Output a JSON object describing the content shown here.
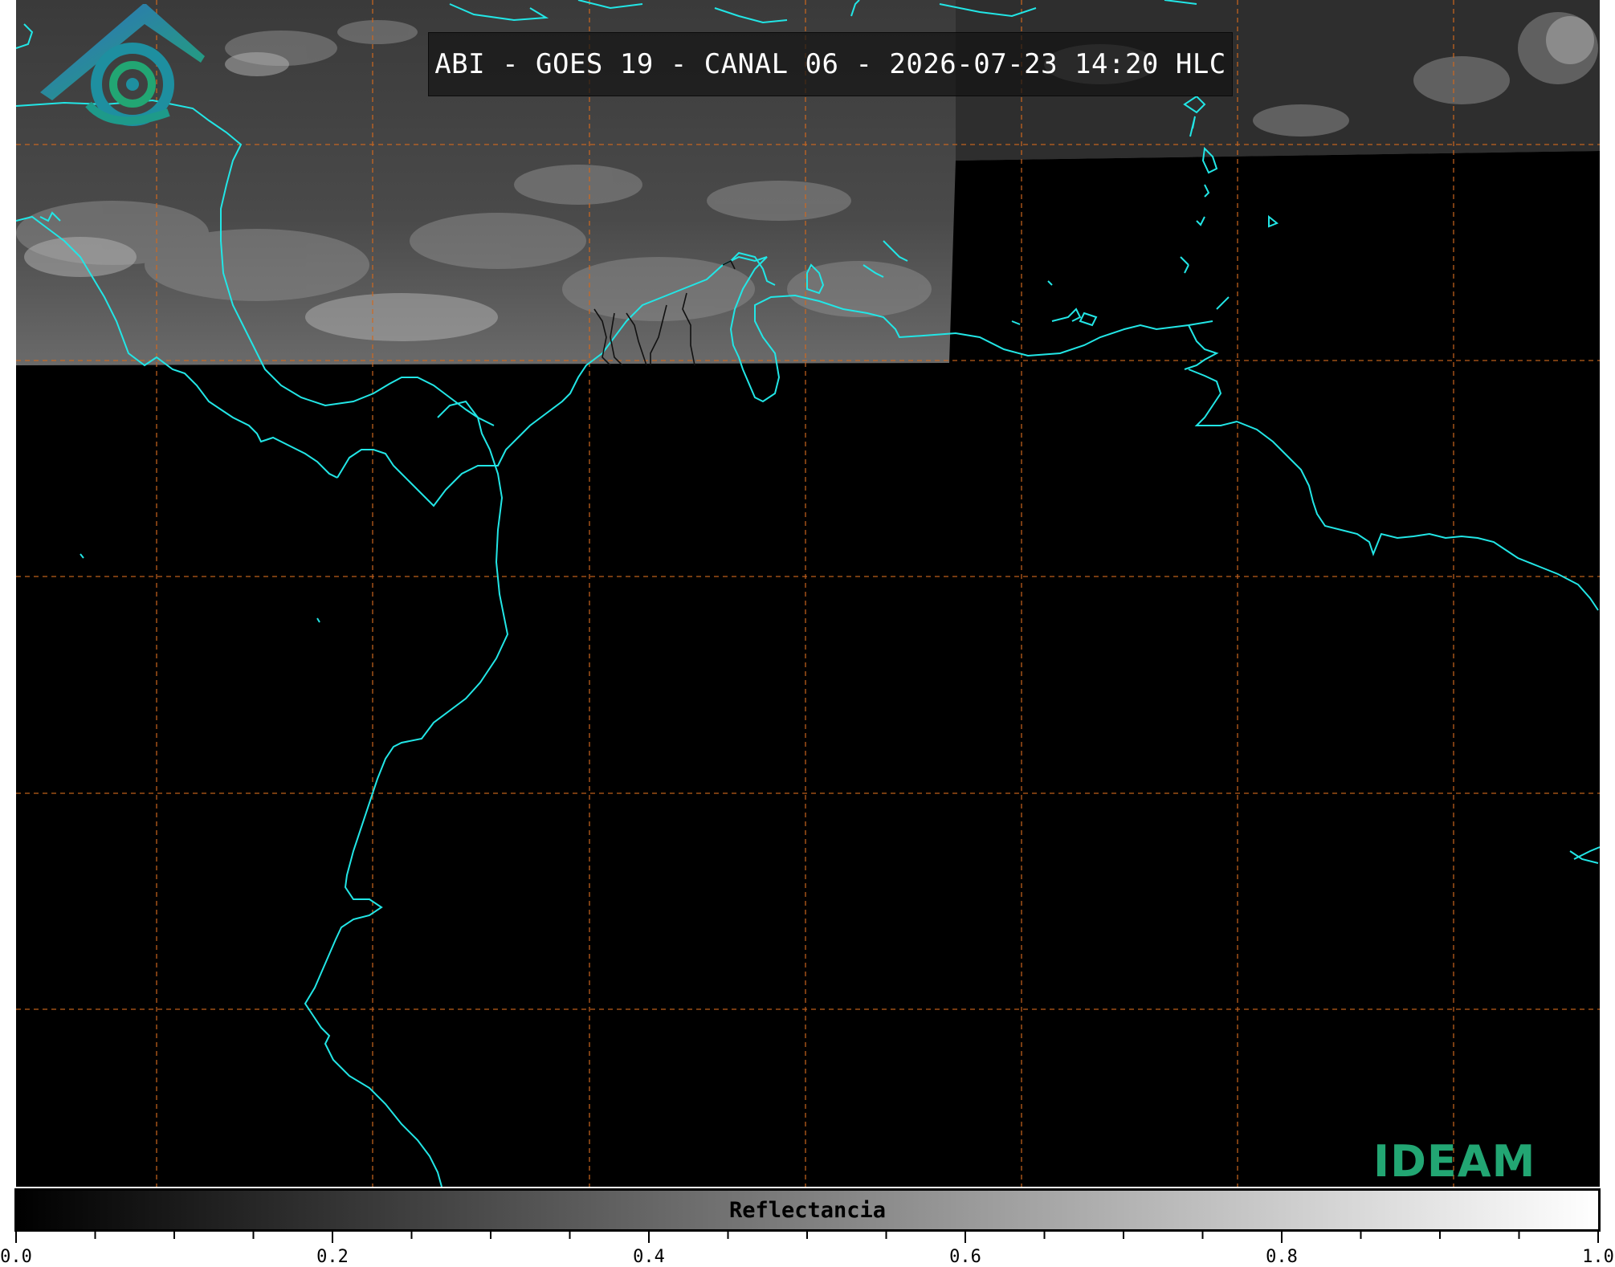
{
  "title": "ABI - GOES 19 - CANAL 06 - 2026-07-23 14:20 HLC",
  "logo": {
    "text": "IDEAM"
  },
  "colorbar": {
    "label": "Reflectancia",
    "range": [
      0.0,
      1.0
    ],
    "gradient": [
      "#000000",
      "#ffffff"
    ],
    "tick_labels": [
      "0.0",
      "0.2",
      "0.4",
      "0.6",
      "0.8",
      "1.0"
    ],
    "tick_values": [
      0.0,
      0.2,
      0.4,
      0.6,
      0.8,
      1.0
    ],
    "minor_step": 0.05
  },
  "colors": {
    "coastline": "#22e6e6",
    "grid": "#d2691e",
    "border": "#000000",
    "logo_teal": "#1e8fa0",
    "logo_green": "#22a673"
  }
}
